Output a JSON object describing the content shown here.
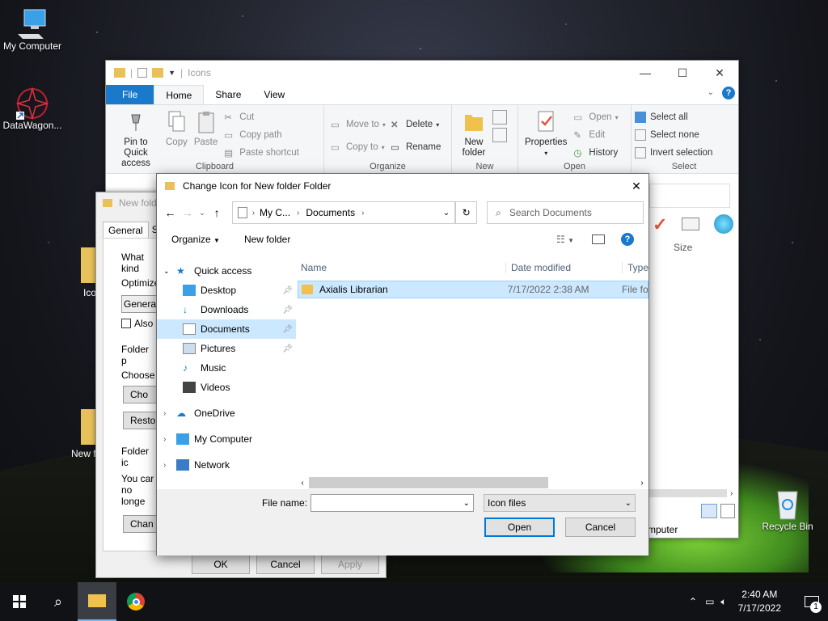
{
  "desktop": {
    "icons": [
      {
        "label": "My Computer",
        "icon": "monitor-icon"
      },
      {
        "label": "DataWagon...",
        "icon": "app-shortcut-icon"
      },
      {
        "label": "Recycle Bin",
        "icon": "recycle-bin-icon"
      }
    ],
    "partial_labels": {
      "ico": "Ico",
      "newf": "New f"
    }
  },
  "explorer": {
    "title": "Icons",
    "tabs": [
      "File",
      "Home",
      "Share",
      "View"
    ],
    "clipboard": {
      "pin": "Pin to Quick access",
      "copy": "Copy",
      "paste": "Paste",
      "cut": "Cut",
      "copy_path": "Copy path",
      "paste_shortcut": "Paste shortcut",
      "group": "Clipboard"
    },
    "organize": {
      "move_to": "Move to",
      "copy_to": "Copy to",
      "delete": "Delete",
      "rename": "Rename",
      "group": "Organize"
    },
    "new": {
      "new_folder": "New folder",
      "group": "New"
    },
    "open": {
      "properties": "Properties",
      "open": "Open",
      "edit": "Edit",
      "history": "History",
      "group": "Open"
    },
    "select": {
      "select_all": "Select all",
      "select_none": "Select none",
      "invert": "Invert selection",
      "group": "Select"
    },
    "size_col": "Size",
    "status_partial": "mputer"
  },
  "props": {
    "title": "New fold",
    "tabs": [
      "General",
      "Sh"
    ],
    "what_kind": "What kind",
    "optimize": "Optimize",
    "general_sel": "Genera",
    "also": "Also",
    "folder_p": "Folder p",
    "choose": "Choose",
    "cho_btn": "Cho",
    "resto_btn": "Resto",
    "folder_ic": "Folder ic",
    "you_can": "You car",
    "no_longer": "no longe",
    "chan_btn": "Chan",
    "ok": "OK",
    "cancel": "Cancel",
    "apply": "Apply"
  },
  "dialog": {
    "title": "Change Icon for New folder Folder",
    "breadcrumb": [
      "My C...",
      "Documents"
    ],
    "search_placeholder": "Search Documents",
    "organize": "Organize",
    "new_folder": "New folder",
    "nav": {
      "quick_access": "Quick access",
      "desktop": "Desktop",
      "downloads": "Downloads",
      "documents": "Documents",
      "pictures": "Pictures",
      "music": "Music",
      "videos": "Videos",
      "onedrive": "OneDrive",
      "my_computer": "My Computer",
      "network": "Network"
    },
    "columns": {
      "name": "Name",
      "date": "Date modified",
      "type": "Type"
    },
    "files": [
      {
        "name": "Axialis Librarian",
        "date": "7/17/2022 2:38 AM",
        "type": "File fo"
      }
    ],
    "file_name_label": "File name:",
    "file_name_value": "",
    "filter": "Icon files",
    "open": "Open",
    "cancel": "Cancel"
  },
  "taskbar": {
    "time": "2:40 AM",
    "date": "7/17/2022",
    "notif_count": "1"
  },
  "colors": {
    "accent": "#0078d7",
    "file_tab": "#1979ca",
    "selection": "#cce8ff",
    "taskbar": "#101215"
  }
}
